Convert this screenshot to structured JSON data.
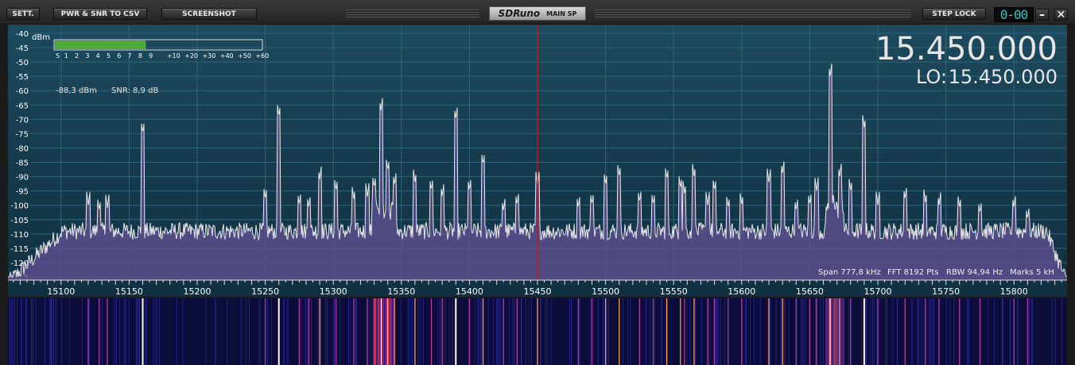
{
  "toolbar": {
    "sett_label": "SETT.",
    "csv_label": "PWR & SNR TO CSV",
    "screenshot_label": "SCREENSHOT",
    "logo_text": "SDRuno",
    "panel_label": "MAIN SP",
    "step_lock_label": "STEP LOCK",
    "clock_text": "0-00",
    "minimize_label": "–",
    "close_label": "✕"
  },
  "smeter": {
    "unit": "dBm",
    "scale": [
      "S",
      "1",
      "2",
      "3",
      "4",
      "5",
      "6",
      "7",
      "8",
      "9",
      "+10",
      "+20",
      "+30",
      "+40",
      "+50",
      "+60"
    ],
    "level_fraction": 0.44,
    "readout_power": "-88,3 dBm",
    "readout_snr": "SNR: 8,9 dB"
  },
  "frequency": {
    "main": "15.450.000",
    "lo_label": "LO:",
    "lo": "15.450.000"
  },
  "info": {
    "span": "Span 777,8 kHz",
    "fft": "FFT 8192 Pts",
    "rbw": "RBW 94,94 Hz",
    "marks": "Marks 5 kH"
  },
  "colors": {
    "spectrum_fill": "#5a4d8c",
    "trace": "#e8e8e8",
    "tuning_line": "#c01818",
    "meter_bar": "#4ea83a",
    "freq_digits": "#e6e6e6",
    "clock_digits": "#2fc6c6"
  },
  "chart_data": {
    "type": "area",
    "ylabel": "dBm",
    "ylim": [
      -125,
      -40
    ],
    "yticks": [
      -40,
      -45,
      -50,
      -55,
      -60,
      -65,
      -70,
      -75,
      -80,
      -85,
      -90,
      -95,
      -100,
      -105,
      -110,
      -115,
      -120,
      -125
    ],
    "xlim": [
      15061,
      15839
    ],
    "xticks": [
      15100,
      15150,
      15200,
      15250,
      15300,
      15350,
      15400,
      15450,
      15500,
      15550,
      15600,
      15650,
      15700,
      15750,
      15800
    ],
    "tuned_khz": 15450,
    "grid": true,
    "noise_floor_dbm": -109,
    "peaks": [
      {
        "x": 15160,
        "y": -75
      },
      {
        "x": 15120,
        "y": -100
      },
      {
        "x": 15128,
        "y": -102
      },
      {
        "x": 15134,
        "y": -101
      },
      {
        "x": 15250,
        "y": -98
      },
      {
        "x": 15260,
        "y": -69
      },
      {
        "x": 15275,
        "y": -100
      },
      {
        "x": 15282,
        "y": -101
      },
      {
        "x": 15290,
        "y": -91
      },
      {
        "x": 15302,
        "y": -95
      },
      {
        "x": 15315,
        "y": -98
      },
      {
        "x": 15325,
        "y": -97
      },
      {
        "x": 15330,
        "y": -94
      },
      {
        "x": 15335,
        "y": -67
      },
      {
        "x": 15340,
        "y": -88
      },
      {
        "x": 15345,
        "y": -93
      },
      {
        "x": 15360,
        "y": -92
      },
      {
        "x": 15372,
        "y": -95
      },
      {
        "x": 15380,
        "y": -97
      },
      {
        "x": 15390,
        "y": -70
      },
      {
        "x": 15400,
        "y": -95
      },
      {
        "x": 15410,
        "y": -86
      },
      {
        "x": 15425,
        "y": -102
      },
      {
        "x": 15435,
        "y": -100
      },
      {
        "x": 15450,
        "y": -93
      },
      {
        "x": 15480,
        "y": -101
      },
      {
        "x": 15490,
        "y": -100
      },
      {
        "x": 15500,
        "y": -93
      },
      {
        "x": 15510,
        "y": -90
      },
      {
        "x": 15525,
        "y": -99
      },
      {
        "x": 15535,
        "y": -100
      },
      {
        "x": 15545,
        "y": -91
      },
      {
        "x": 15555,
        "y": -94
      },
      {
        "x": 15558,
        "y": -96
      },
      {
        "x": 15565,
        "y": -90
      },
      {
        "x": 15575,
        "y": -100
      },
      {
        "x": 15580,
        "y": -95
      },
      {
        "x": 15590,
        "y": -101
      },
      {
        "x": 15600,
        "y": -100
      },
      {
        "x": 15620,
        "y": -92
      },
      {
        "x": 15630,
        "y": -89
      },
      {
        "x": 15640,
        "y": -102
      },
      {
        "x": 15650,
        "y": -100
      },
      {
        "x": 15655,
        "y": -95
      },
      {
        "x": 15665,
        "y": -55
      },
      {
        "x": 15672,
        "y": -90
      },
      {
        "x": 15680,
        "y": -95
      },
      {
        "x": 15690,
        "y": -73
      },
      {
        "x": 15700,
        "y": -100
      },
      {
        "x": 15720,
        "y": -98
      },
      {
        "x": 15735,
        "y": -99
      },
      {
        "x": 15745,
        "y": -100
      },
      {
        "x": 15760,
        "y": -101
      },
      {
        "x": 15775,
        "y": -103
      },
      {
        "x": 15800,
        "y": -101
      },
      {
        "x": 15810,
        "y": -105
      }
    ]
  }
}
